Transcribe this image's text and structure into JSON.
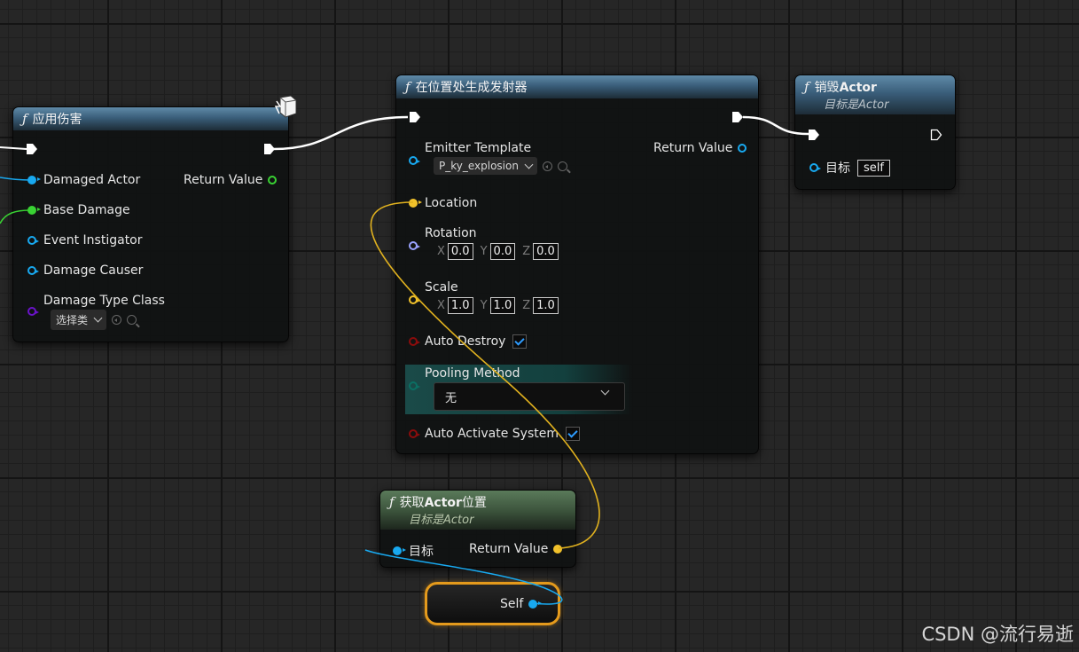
{
  "nodes": {
    "apply_damage": {
      "title": "应用伤害",
      "pins": {
        "damaged_actor": "Damaged Actor",
        "base_damage": "Base Damage",
        "event_instigator": "Event Instigator",
        "damage_causer": "Damage Causer",
        "damage_type_class": "Damage Type Class",
        "return_value": "Return Value"
      },
      "class_picker": "选择类"
    },
    "spawn_emitter": {
      "title": "在位置处生成发射器",
      "pins": {
        "emitter_template": "Emitter Template",
        "return_value": "Return Value",
        "location": "Location",
        "rotation": "Rotation",
        "scale": "Scale",
        "auto_destroy": "Auto Destroy",
        "pooling_method": "Pooling Method",
        "auto_activate_system": "Auto Activate System"
      },
      "emitter_value": "P_ky_explosion",
      "axis": {
        "x": "X",
        "y": "Y",
        "z": "Z"
      },
      "rotation": {
        "x": "0.0",
        "y": "0.0",
        "z": "0.0"
      },
      "scale": {
        "x": "1.0",
        "y": "1.0",
        "z": "1.0"
      },
      "auto_destroy": true,
      "auto_activate": true,
      "pooling_value": "无"
    },
    "destroy_actor": {
      "title_prefix": "销毁",
      "title_bold": "Actor",
      "subtitle_prefix": "目标是",
      "subtitle_italic": "Actor",
      "target_label": "目标",
      "target_value": "self"
    },
    "get_actor_location": {
      "title_prefix": "获取",
      "title_bold": "Actor",
      "title_suffix": "位置",
      "subtitle_prefix": "目标是",
      "subtitle_italic": "Actor",
      "target_label": "目标",
      "return_value": "Return Value"
    },
    "self": {
      "label": "Self"
    }
  },
  "function_icon": "ƒ",
  "watermark": "CSDN @流行易逝",
  "colors": {
    "exec": "#ffffff",
    "object_pin": "#18a9f0",
    "float_pin": "#39d233",
    "class_pin": "#6a13c9",
    "vector_pin": "#f2c22b",
    "rotator_pin": "#9aa3ff",
    "bool_pin": "#8b0c0c",
    "enum_pin": "#0b6f63",
    "return_green": "#39d233",
    "self_border": "#e49a1c"
  },
  "icons": [
    "function-icon",
    "exec-pin-icon",
    "chevron-down-icon",
    "search-icon",
    "browse-icon",
    "check-icon",
    "cube-icon"
  ]
}
